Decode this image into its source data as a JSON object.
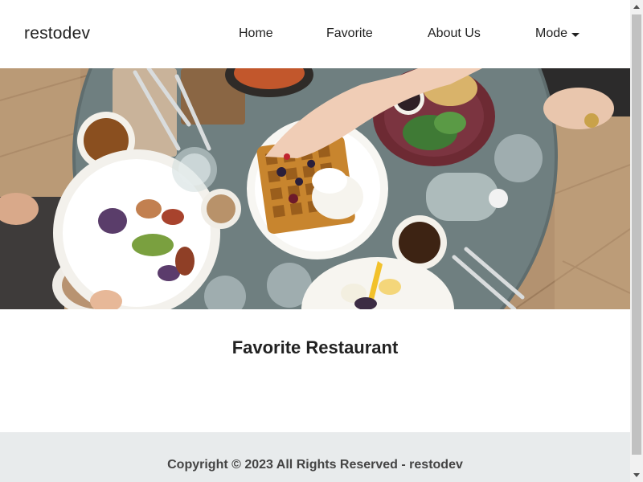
{
  "header": {
    "brand": "restodev",
    "nav": {
      "home": "Home",
      "favorite": "Favorite",
      "about": "About Us",
      "mode": "Mode"
    }
  },
  "main": {
    "title": "Favorite Restaurant"
  },
  "footer": {
    "copyright": "Copyright © 2023 All Rights Reserved - restodev"
  },
  "colors": {
    "background": "#ffffff",
    "footer_bg": "#e8ebec",
    "text": "#222222",
    "footer_text": "#444444"
  },
  "icons": {
    "mode_caret": "caret-down-icon"
  }
}
